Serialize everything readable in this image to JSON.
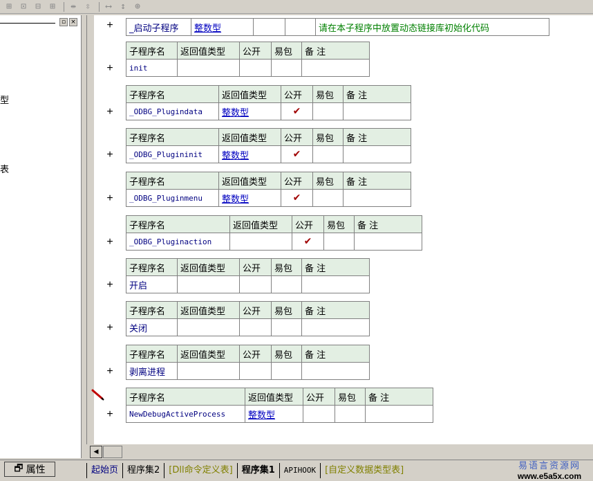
{
  "toolbar": {
    "icons": [
      "align-left-icon",
      "align-center-icon",
      "align-top-icon",
      "align-middle-icon",
      "space-horizontal-icon",
      "space-vertical-icon",
      "same-width-icon",
      "same-height-icon",
      "same-size-icon"
    ]
  },
  "left_panel": {
    "fragments": [
      "型",
      "表"
    ]
  },
  "first_row": {
    "name": "_启动子程序",
    "return_type": "整数型",
    "comment": "请在本子程序中放置动态链接库初始化代码"
  },
  "headers": {
    "name": "子程序名",
    "return_type": "返回值类型",
    "public": "公开",
    "easy": "易包",
    "comment": "备 注"
  },
  "subroutines": [
    {
      "name": "init",
      "return_type": "",
      "public": ""
    },
    {
      "name": "_ODBG_Plugindata",
      "return_type": "整数型",
      "public": "✔"
    },
    {
      "name": "_ODBG_Plugininit",
      "return_type": "整数型",
      "public": "✔"
    },
    {
      "name": "_ODBG_Pluginmenu",
      "return_type": "整数型",
      "public": "✔"
    },
    {
      "name": "_ODBG_Pluginaction",
      "return_type": "",
      "public": "✔"
    },
    {
      "name": "开启",
      "return_type": "",
      "public": ""
    },
    {
      "name": "关闭",
      "return_type": "",
      "public": ""
    },
    {
      "name": "剥离进程",
      "return_type": "",
      "public": ""
    },
    {
      "name": "NewDebugActiveProcess",
      "return_type": "整数型",
      "public": ""
    }
  ],
  "bottom": {
    "properties_label": "属性",
    "tabs": [
      "起始页",
      "程序集2",
      "[Dll命令定义表]",
      "程序集1",
      "APIHOOK",
      "[自定义数据类型表]"
    ]
  },
  "logo": {
    "top": "易语言资源网",
    "bottom": "www.e5a5x.com"
  }
}
